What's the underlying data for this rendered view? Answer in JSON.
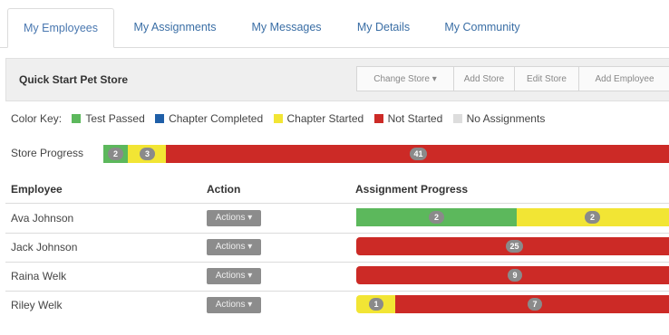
{
  "tabs": [
    {
      "label": "My Employees",
      "active": true
    },
    {
      "label": "My Assignments",
      "active": false
    },
    {
      "label": "My Messages",
      "active": false
    },
    {
      "label": "My Details",
      "active": false
    },
    {
      "label": "My Community",
      "active": false
    }
  ],
  "panel": {
    "title": "Quick Start Pet Store",
    "buttons": [
      "Change Store ▾",
      "Add Store",
      "Edit Store",
      "Add Employee"
    ]
  },
  "color_key": {
    "label": "Color Key:",
    "items": [
      {
        "label": "Test Passed",
        "color": "#5cb85c"
      },
      {
        "label": "Chapter Completed",
        "color": "#1f5fa8"
      },
      {
        "label": "Chapter Started",
        "color": "#f2e534"
      },
      {
        "label": "Not Started",
        "color": "#cc2a26"
      },
      {
        "label": "No Assignments",
        "color": "#dddddd"
      }
    ]
  },
  "store_progress": {
    "label": "Store Progress",
    "segments": [
      {
        "status": "Test Passed",
        "count": "2"
      },
      {
        "status": "Chapter Started",
        "count": "3"
      },
      {
        "status": "Not Started",
        "count": "41"
      }
    ]
  },
  "table": {
    "headers": {
      "employee": "Employee",
      "action": "Action",
      "progress": "Assignment Progress"
    },
    "actions_label": "Actions ▾",
    "rows": [
      {
        "name": "Ava Johnson",
        "segments": [
          {
            "status": "Test Passed",
            "count": "2"
          },
          {
            "status": "Chapter Started",
            "count": "2"
          }
        ]
      },
      {
        "name": "Jack Johnson",
        "segments": [
          {
            "status": "Not Started",
            "count": "25"
          }
        ]
      },
      {
        "name": "Raina Welk",
        "segments": [
          {
            "status": "Not Started",
            "count": "9"
          }
        ]
      },
      {
        "name": "Riley Welk",
        "segments": [
          {
            "status": "Chapter Started",
            "count": "1"
          },
          {
            "status": "Not Started",
            "count": "7"
          }
        ]
      }
    ]
  }
}
